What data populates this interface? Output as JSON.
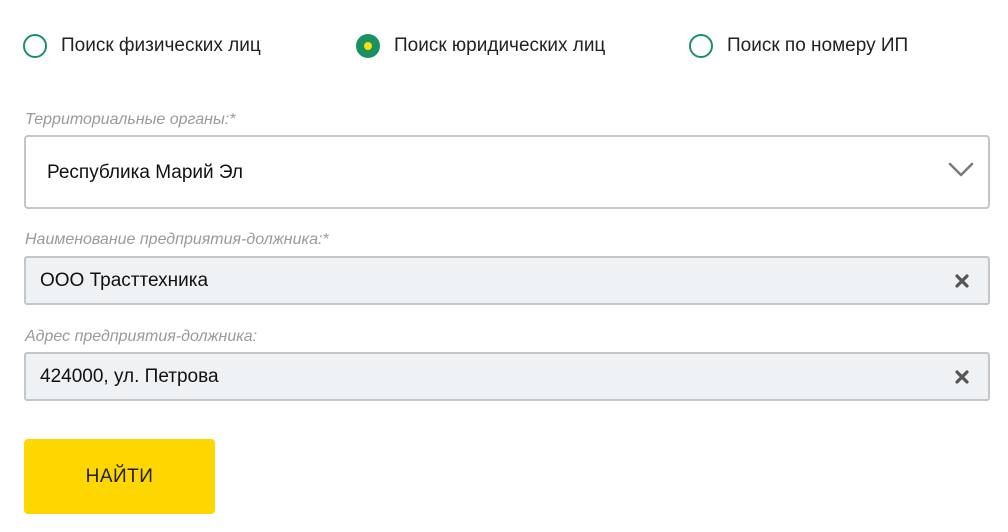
{
  "search_type": {
    "options": [
      {
        "label": "Поиск физических лиц",
        "checked": false
      },
      {
        "label": "Поиск юридических лиц",
        "checked": true
      },
      {
        "label": "Поиск по номеру ИП",
        "checked": false
      }
    ]
  },
  "territory": {
    "label": "Территориальные органы:*",
    "value": "Республика Марий Эл"
  },
  "company_name": {
    "label": "Наименование предприятия-должника:*",
    "value": "ООО Трасттехника"
  },
  "company_address": {
    "label": "Адрес предприятия-должника:",
    "value": "424000, ул. Петрова"
  },
  "submit": {
    "label": "НАЙТИ"
  },
  "icons": {
    "dropdown": "chevron-down-icon",
    "clear": "clear-x-icon"
  },
  "colors": {
    "radio_border": "#1b9163",
    "radio_dot": "#ffe000",
    "button_bg": "#ffd700",
    "input_bg": "#eff2f4",
    "label_muted": "#9a9a9a"
  }
}
